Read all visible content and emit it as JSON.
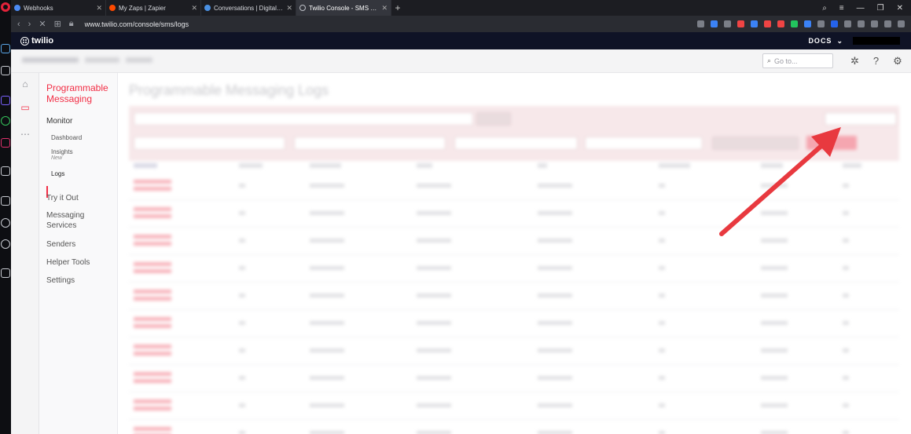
{
  "browser": {
    "tabs": [
      {
        "label": "Webhooks",
        "fav_color": "#4c8bf5"
      },
      {
        "label": "My Zaps | Zapier",
        "fav_color": "#ff4a00"
      },
      {
        "label": "Conversations | Digital Age",
        "fav_color": "#4a90e2"
      },
      {
        "label": "Twilio Console - SMS Logs",
        "fav_color": "#bfc2c9"
      }
    ],
    "new_tab": "+",
    "url": "www.twilio.com/console/sms/logs"
  },
  "twilio": {
    "logo_text": "twilio",
    "docs_label": "DOCS",
    "goto_placeholder": "Go to..."
  },
  "nav": {
    "product_title": "Programmable Messaging",
    "monitor": "Monitor",
    "dashboard": "Dashboard",
    "insights": "Insights",
    "insights_tag": "New",
    "logs": "Logs",
    "items": [
      "Try it Out",
      "Messaging Services",
      "Senders",
      "Helper Tools",
      "Settings"
    ]
  },
  "content": {
    "title": "Programmable Messaging Logs"
  },
  "colors": {
    "accent": "#f22f46",
    "arrow": "#e8393f"
  }
}
